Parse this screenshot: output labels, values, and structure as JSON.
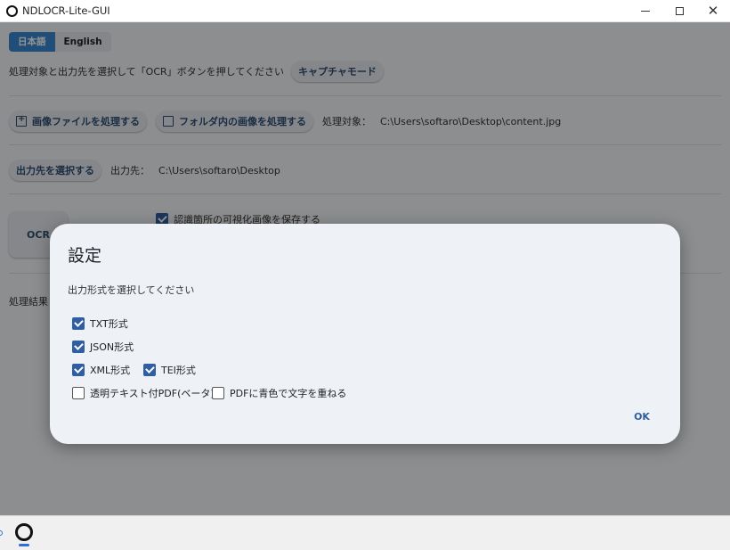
{
  "window": {
    "title": "NDLOCR-Lite-GUI"
  },
  "language": {
    "options": [
      "日本語",
      "English"
    ],
    "selected": "日本語"
  },
  "main": {
    "instruction": "処理対象と出力先を選択して「OCR」ボタンを押してください",
    "capture_mode_label": "キャプチャモード",
    "process_image_label": "画像ファイルを処理する",
    "process_folder_label": "フォルダ内の画像を処理する",
    "target_label": "処理対象：",
    "target_value": "C:\\Users\\softaro\\Desktop\\content.jpg",
    "select_output_label": "出力先を選択する",
    "output_label": "出力先：",
    "output_value": "C:\\Users\\softaro\\Desktop",
    "ocr_button_label": "OCR",
    "save_visualization_label": "認識箇所の可視化画像を保存する",
    "save_visualization_checked": true,
    "result_label": "処理結果"
  },
  "dialog": {
    "title": "設定",
    "subtitle": "出力形式を選択してください",
    "options": [
      {
        "label": "TXT形式",
        "checked": true
      },
      {
        "label": "JSON形式",
        "checked": true
      },
      {
        "label": "XML形式",
        "checked": true
      },
      {
        "label": "TEI形式",
        "checked": true
      },
      {
        "label": "透明テキスト付PDF(ベータ)",
        "checked": false
      },
      {
        "label": "PDFに青色で文字を重ねる",
        "checked": false
      }
    ],
    "ok_label": "OK"
  },
  "colors": {
    "accent": "#2f5fa0",
    "language_active": "#3a86d1",
    "scrim": "rgba(0,0,0,0.42)"
  }
}
